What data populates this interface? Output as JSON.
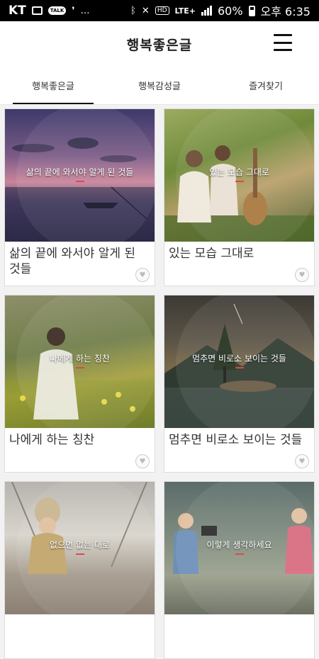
{
  "status_bar": {
    "carrier": "KT",
    "battery": "60%",
    "time": "오후 6:35",
    "network": "LTE+"
  },
  "app": {
    "title": "행복좋은글"
  },
  "tabs": [
    {
      "label": "행복좋은글",
      "active": true
    },
    {
      "label": "행복감성글",
      "active": false
    },
    {
      "label": "즐겨찾기",
      "active": false
    }
  ],
  "cards": [
    {
      "overlay": "삶의 끝에 와서야 알게 된 것들",
      "title": "삶의 끝에 와서야 알게 된 것들"
    },
    {
      "overlay": "있는 모습 그대로",
      "title": "있는 모습 그대로"
    },
    {
      "overlay": "나에게 하는 칭찬",
      "title": "나에게 하는 칭찬"
    },
    {
      "overlay": "멈추면 비로소 보이는 것들",
      "title": "멈추면 비로소 보이는 것들"
    },
    {
      "overlay": "없으면 없는 대로",
      "title": ""
    },
    {
      "overlay": "이렇게 생각하세요",
      "title": ""
    }
  ],
  "colors": {
    "accent_underline": "#e04848",
    "status_bar_bg": "#000000",
    "page_bg": "#f2f2f2"
  },
  "icons": {
    "menu": "hamburger-menu-icon",
    "favorite": "heart-icon"
  }
}
